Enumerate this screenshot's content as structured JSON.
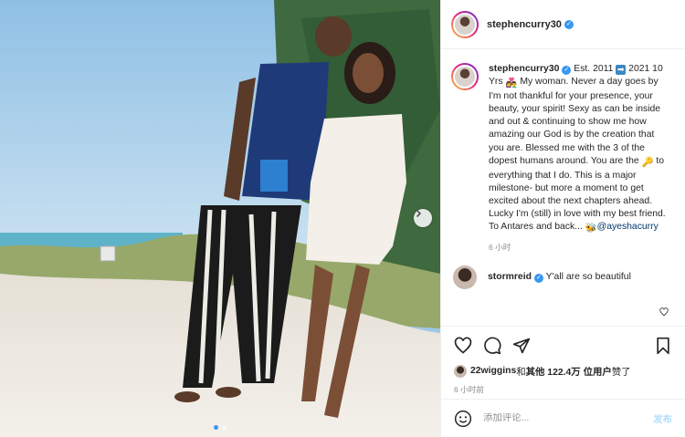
{
  "header": {
    "username": "stephencurry30"
  },
  "caption": {
    "username": "stephencurry30",
    "text_1": " Est. 2011 ",
    "arrow_emoji": "➡",
    "text_2": " 2021 10 Yrs ",
    "couple_emoji": "👩‍❤️‍👨",
    "text_3": " My woman. Never a day goes by I'm not thankful for your presence, your beauty, your spirit! Sexy as can be inside and out & continuing to show me how amazing our God is by the creation that you are. Blessed me with the 3 of the dopest humans around. You are the ",
    "key_emoji": "🔑",
    "text_4": " to everything that I do. This is a major milestone- but more a moment to get excited about the next chapters ahead. Lucky I'm (still) in love with my best friend. To Antares and back... ",
    "bee_emoji": "🐝",
    "mention": "@ayeshacurry",
    "time": "6 小时"
  },
  "reply": {
    "username": "stormreid",
    "text": "Y'all are so beautiful"
  },
  "likes": {
    "liker": "22wiggins",
    "connector": " 和 ",
    "others_label": "其他 122.4万 位用户",
    "suffix": " 赞了"
  },
  "post_time": "6 小时前",
  "composer": {
    "placeholder": "添加评论...",
    "post_label": "发布"
  },
  "colors": {
    "verified": "#3897f0",
    "link": "#00376b",
    "post_disabled": "#b2dffc"
  },
  "photo": {
    "carousel_pages": 2,
    "carousel_current": 1
  }
}
